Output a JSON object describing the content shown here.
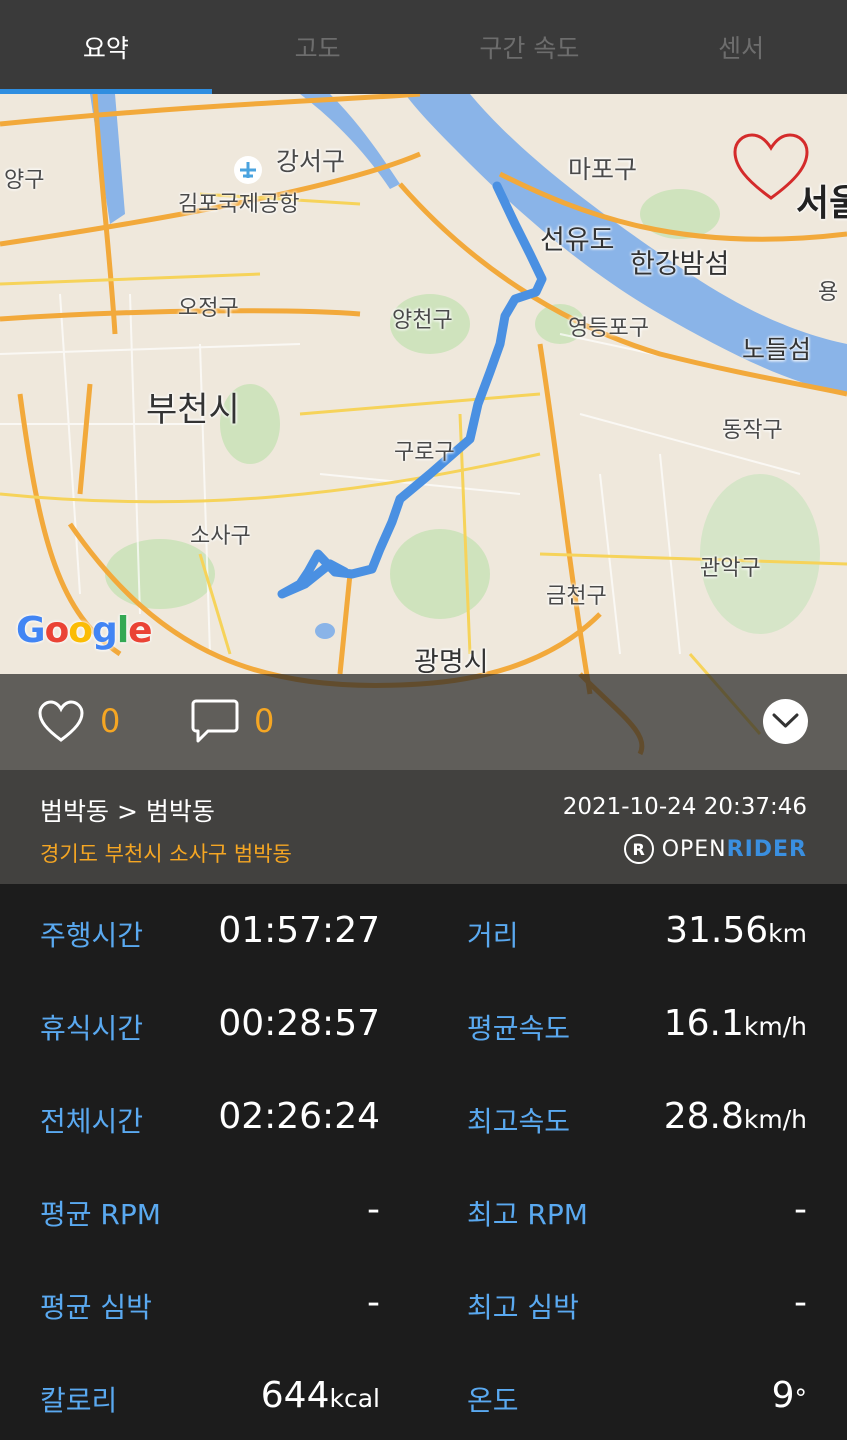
{
  "tabs": [
    {
      "label": "요약"
    },
    {
      "label": "고도"
    },
    {
      "label": "구간 속도"
    },
    {
      "label": "센서"
    }
  ],
  "map": {
    "labels": [
      "양구",
      "강서구",
      "김포국제공항",
      "마포구",
      "서울",
      "선유도",
      "한강밤섬",
      "용",
      "오정구",
      "양천구",
      "영등포구",
      "노들섬",
      "부천시",
      "동작구",
      "구로구",
      "소사구",
      "관악구",
      "금천구",
      "광명시"
    ],
    "logo": [
      "G",
      "o",
      "o",
      "g",
      "l",
      "e"
    ],
    "route_color": "#4a90e2",
    "favorite_icon": "heart-outline-icon"
  },
  "social": {
    "likes": "0",
    "comments": "0"
  },
  "route": {
    "title": "범박동 > 범박동",
    "address": "경기도 부천시 소사구 범박동",
    "datetime": "2021-10-24 20:37:46",
    "brand_logo_letter": "R",
    "brand_open": "OPEN",
    "brand_rider": "RIDER"
  },
  "stats": [
    {
      "label": "주행시간",
      "value": "01:57:27",
      "unit": "",
      "label2": "거리",
      "value2": "31.56",
      "unit2": "km"
    },
    {
      "label": "휴식시간",
      "value": "00:28:57",
      "unit": "",
      "label2": "평균속도",
      "value2": "16.1",
      "unit2": "km/h"
    },
    {
      "label": "전체시간",
      "value": "02:26:24",
      "unit": "",
      "label2": "최고속도",
      "value2": "28.8",
      "unit2": "km/h"
    },
    {
      "label": "평균 RPM",
      "value": "-",
      "unit": "",
      "label2": "최고 RPM",
      "value2": "-",
      "unit2": ""
    },
    {
      "label": "평균 심박",
      "value": "-",
      "unit": "",
      "label2": "최고 심박",
      "value2": "-",
      "unit2": ""
    },
    {
      "label": "칼로리",
      "value": "644",
      "unit": "kcal",
      "label2": "온도",
      "value2": "9",
      "unit2": "°"
    }
  ],
  "colors": {
    "accent_blue": "#2f8ee0",
    "label_blue": "#5aa9f0",
    "orange": "#f5a623"
  }
}
